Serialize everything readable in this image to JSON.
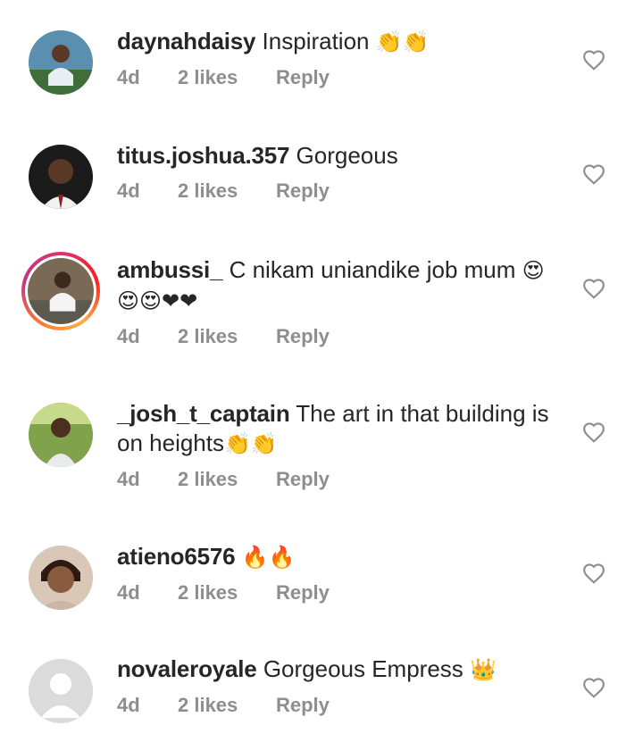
{
  "comments": [
    {
      "username": "daynahdaisy",
      "text": "Inspiration",
      "emoji": "👏👏",
      "time": "4d",
      "likes": "2 likes",
      "reply": "Reply"
    },
    {
      "username": "titus.joshua.357",
      "text": "Gorgeous",
      "emoji": "",
      "time": "4d",
      "likes": "2 likes",
      "reply": "Reply"
    },
    {
      "username": "ambussi_",
      "text": "C nikam uniandike job mum",
      "emoji": "😍😍😍❤❤",
      "time": "4d",
      "likes": "2 likes",
      "reply": "Reply"
    },
    {
      "username": "_josh_t_captain",
      "text": "The art in that building is on heights",
      "emoji": "👏👏",
      "time": "4d",
      "likes": "2 likes",
      "reply": "Reply"
    },
    {
      "username": "atieno6576",
      "text": "",
      "emoji": "🔥🔥",
      "time": "4d",
      "likes": "2 likes",
      "reply": "Reply"
    },
    {
      "username": "novaleroyale",
      "text": "Gorgeous Empress",
      "emoji": "👑",
      "time": "4d",
      "likes": "2 likes",
      "reply": "Reply"
    }
  ],
  "icons": {
    "like": "heart-outline-icon",
    "default_avatar": "person-silhouette-icon"
  },
  "colors": {
    "meta": "#8e8e8e",
    "text": "#262626",
    "story_ring": "#e1306c"
  }
}
